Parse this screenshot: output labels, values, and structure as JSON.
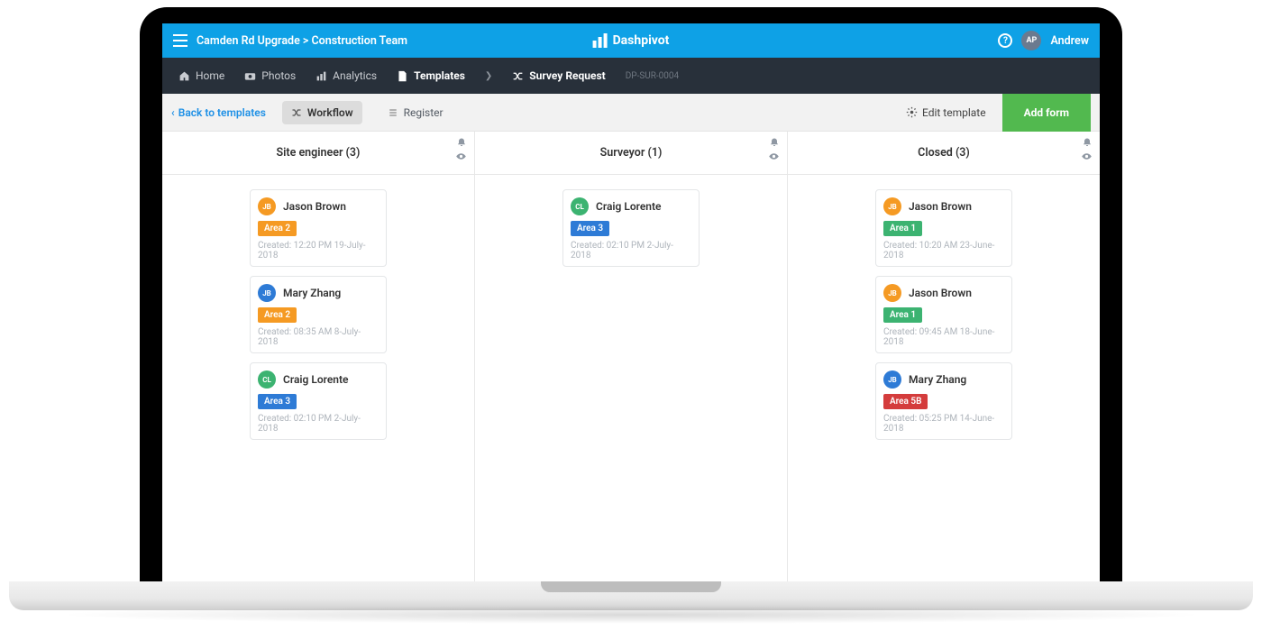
{
  "colors": {
    "avatar_orange": "#f59a23",
    "avatar_green": "#3cb371",
    "avatar_blue": "#2e7bd6",
    "tag_orange": "#f59a23",
    "tag_blue": "#2e7bd6",
    "tag_green": "#3cb371",
    "tag_red": "#d43c3c"
  },
  "topbar": {
    "breadcrumb": "Camden Rd Upgrade > Construction Team",
    "brand": "Dashpivot",
    "user_initials": "AP",
    "user_name": "Andrew"
  },
  "nav": {
    "home": "Home",
    "photos": "Photos",
    "analytics": "Analytics",
    "templates": "Templates",
    "sub": "Survey Request",
    "code": "DP-SUR-0004"
  },
  "toolbar": {
    "back": "Back to templates",
    "workflow": "Workflow",
    "register": "Register",
    "edit": "Edit template",
    "add": "Add form"
  },
  "columns": [
    {
      "title": "Site engineer (3)",
      "cards": [
        {
          "avatar_initials": "JB",
          "avatar_color": "#f59a23",
          "name": "Jason Brown",
          "tag": "Area 2",
          "tag_color": "#f59a23",
          "created": "Created: 12:20 PM 19-July-2018"
        },
        {
          "avatar_initials": "JB",
          "avatar_color": "#2e7bd6",
          "name": "Mary Zhang",
          "tag": "Area 2",
          "tag_color": "#f59a23",
          "created": "Created: 08:35 AM 8-July-2018"
        },
        {
          "avatar_initials": "CL",
          "avatar_color": "#3cb371",
          "name": "Craig Lorente",
          "tag": "Area 3",
          "tag_color": "#2e7bd6",
          "created": "Created: 02:10 PM 2-July-2018"
        }
      ]
    },
    {
      "title": "Surveyor (1)",
      "cards": [
        {
          "avatar_initials": "CL",
          "avatar_color": "#3cb371",
          "name": "Craig Lorente",
          "tag": "Area 3",
          "tag_color": "#2e7bd6",
          "created": "Created: 02:10 PM 2-July-2018"
        }
      ]
    },
    {
      "title": "Closed (3)",
      "cards": [
        {
          "avatar_initials": "JB",
          "avatar_color": "#f59a23",
          "name": "Jason Brown",
          "tag": "Area 1",
          "tag_color": "#3cb371",
          "created": "Created: 10:20 AM 23-June-2018"
        },
        {
          "avatar_initials": "JB",
          "avatar_color": "#f59a23",
          "name": "Jason Brown",
          "tag": "Area 1",
          "tag_color": "#3cb371",
          "created": "Created: 09:45 AM 18-June-2018"
        },
        {
          "avatar_initials": "JB",
          "avatar_color": "#2e7bd6",
          "name": "Mary Zhang",
          "tag": "Area 5B",
          "tag_color": "#d43c3c",
          "created": "Created: 05:25 PM 14-June-2018"
        }
      ]
    }
  ]
}
